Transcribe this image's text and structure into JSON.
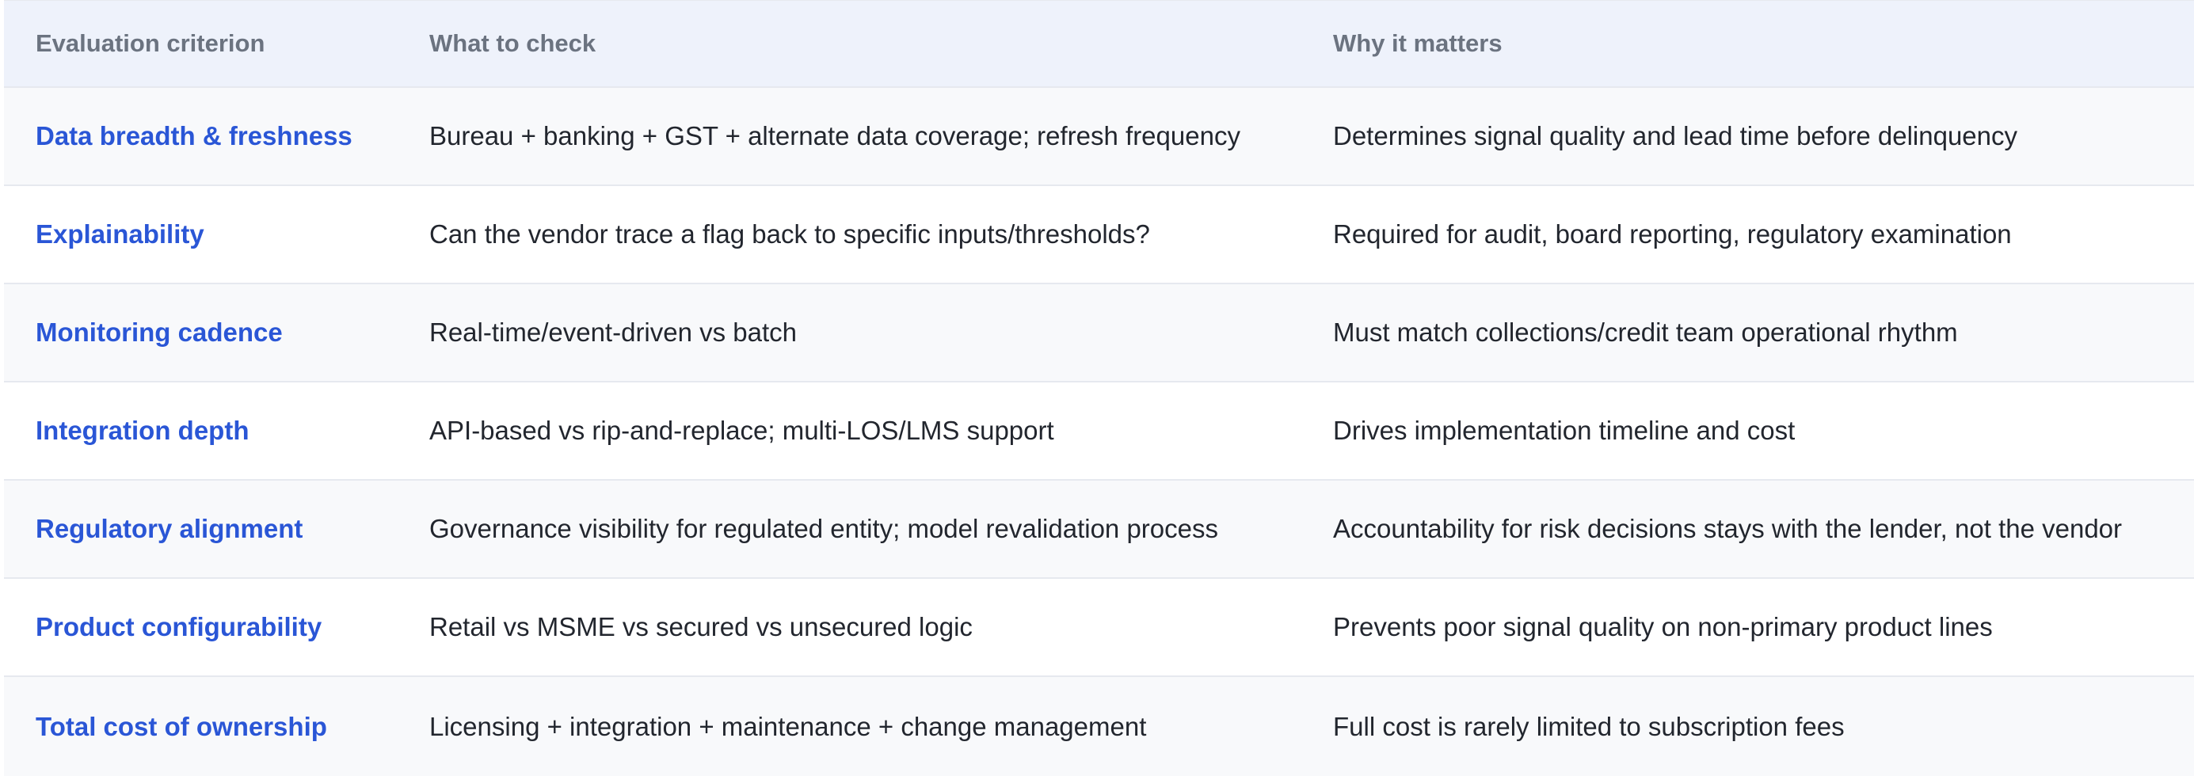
{
  "table": {
    "headers": [
      "Evaluation criterion",
      "What to check",
      "Why it matters"
    ],
    "rows": [
      {
        "criterion": "Data breadth & freshness",
        "check": "Bureau + banking + GST + alternate data coverage; refresh frequency",
        "why": "Determines signal quality and lead time before delinquency"
      },
      {
        "criterion": "Explainability",
        "check": "Can the vendor trace a flag back to specific inputs/thresholds?",
        "why": "Required for audit, board reporting, regulatory examination"
      },
      {
        "criterion": "Monitoring cadence",
        "check": "Real-time/event-driven vs batch",
        "why": "Must match collections/credit team operational rhythm"
      },
      {
        "criterion": "Integration depth",
        "check": "API-based vs rip-and-replace; multi-LOS/LMS support",
        "why": "Drives implementation timeline and cost"
      },
      {
        "criterion": "Regulatory alignment",
        "check": "Governance visibility for regulated entity; model revalidation process",
        "why": "Accountability for risk decisions stays with the lender, not the vendor"
      },
      {
        "criterion": "Product configurability",
        "check": "Retail vs MSME vs secured vs unsecured logic",
        "why": "Prevents poor signal quality on non-primary product lines"
      },
      {
        "criterion": "Total cost of ownership",
        "check": "Licensing + integration + maintenance + change management",
        "why": "Full cost is rarely limited to subscription fees"
      }
    ]
  },
  "colors": {
    "header_bg": "#eef2fb",
    "header_text": "#6b7380",
    "criterion_text": "#2a56d6",
    "body_text": "#22262e",
    "stripe_bg": "#f8f9fb",
    "divider": "#e6e9ef"
  }
}
